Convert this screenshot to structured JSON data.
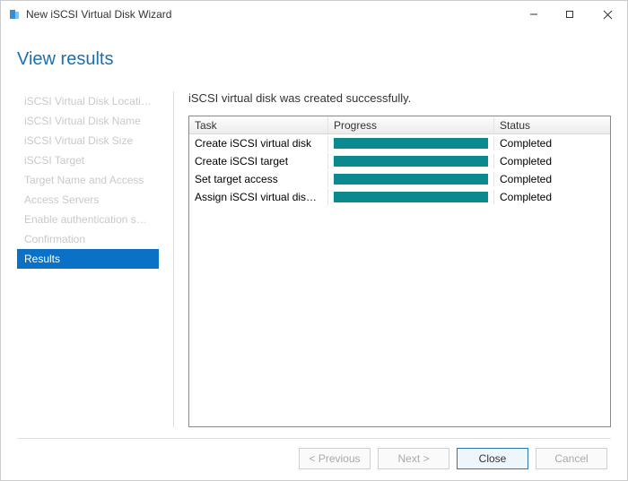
{
  "window": {
    "title": "New iSCSI Virtual Disk Wizard"
  },
  "heading": "View results",
  "sidebar": {
    "items": [
      {
        "label": "iSCSI Virtual Disk Location",
        "active": false
      },
      {
        "label": "iSCSI Virtual Disk Name",
        "active": false
      },
      {
        "label": "iSCSI Virtual Disk Size",
        "active": false
      },
      {
        "label": "iSCSI Target",
        "active": false
      },
      {
        "label": "Target Name and Access",
        "active": false
      },
      {
        "label": "Access Servers",
        "active": false
      },
      {
        "label": "Enable authentication ser...",
        "active": false
      },
      {
        "label": "Confirmation",
        "active": false
      },
      {
        "label": "Results",
        "active": true
      }
    ]
  },
  "detail": {
    "message": "iSCSI virtual disk was created successfully.",
    "columns": {
      "task": "Task",
      "progress": "Progress",
      "status": "Status"
    },
    "rows": [
      {
        "task": "Create iSCSI virtual disk",
        "status": "Completed"
      },
      {
        "task": "Create iSCSI target",
        "status": "Completed"
      },
      {
        "task": "Set target access",
        "status": "Completed"
      },
      {
        "task": "Assign iSCSI virtual disk to target",
        "status": "Completed"
      }
    ]
  },
  "buttons": {
    "previous": "< Previous",
    "next": "Next >",
    "close": "Close",
    "cancel": "Cancel"
  }
}
